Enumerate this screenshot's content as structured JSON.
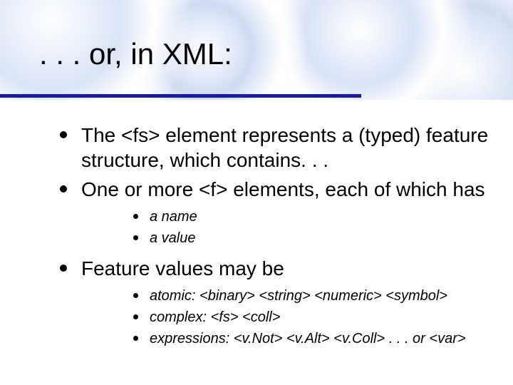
{
  "slide": {
    "title": ". . . or, in XML:",
    "bullets": [
      {
        "text": "The <fs> element represents a  (typed) feature structure, which contains. . .",
        "sub": []
      },
      {
        "text": "One or more <f> elements, each of which has",
        "sub": [
          {
            "text": "a name"
          },
          {
            "text": "a value"
          }
        ]
      },
      {
        "text": "Feature values may be",
        "sub": [
          {
            "text": "atomic: <binary> <string> <numeric> <symbol>"
          },
          {
            "text": "complex: <fs> <coll>"
          },
          {
            "text": "expressions: <v.Not> <v.Alt> <v.Coll> . . . or <var>"
          }
        ]
      }
    ]
  }
}
